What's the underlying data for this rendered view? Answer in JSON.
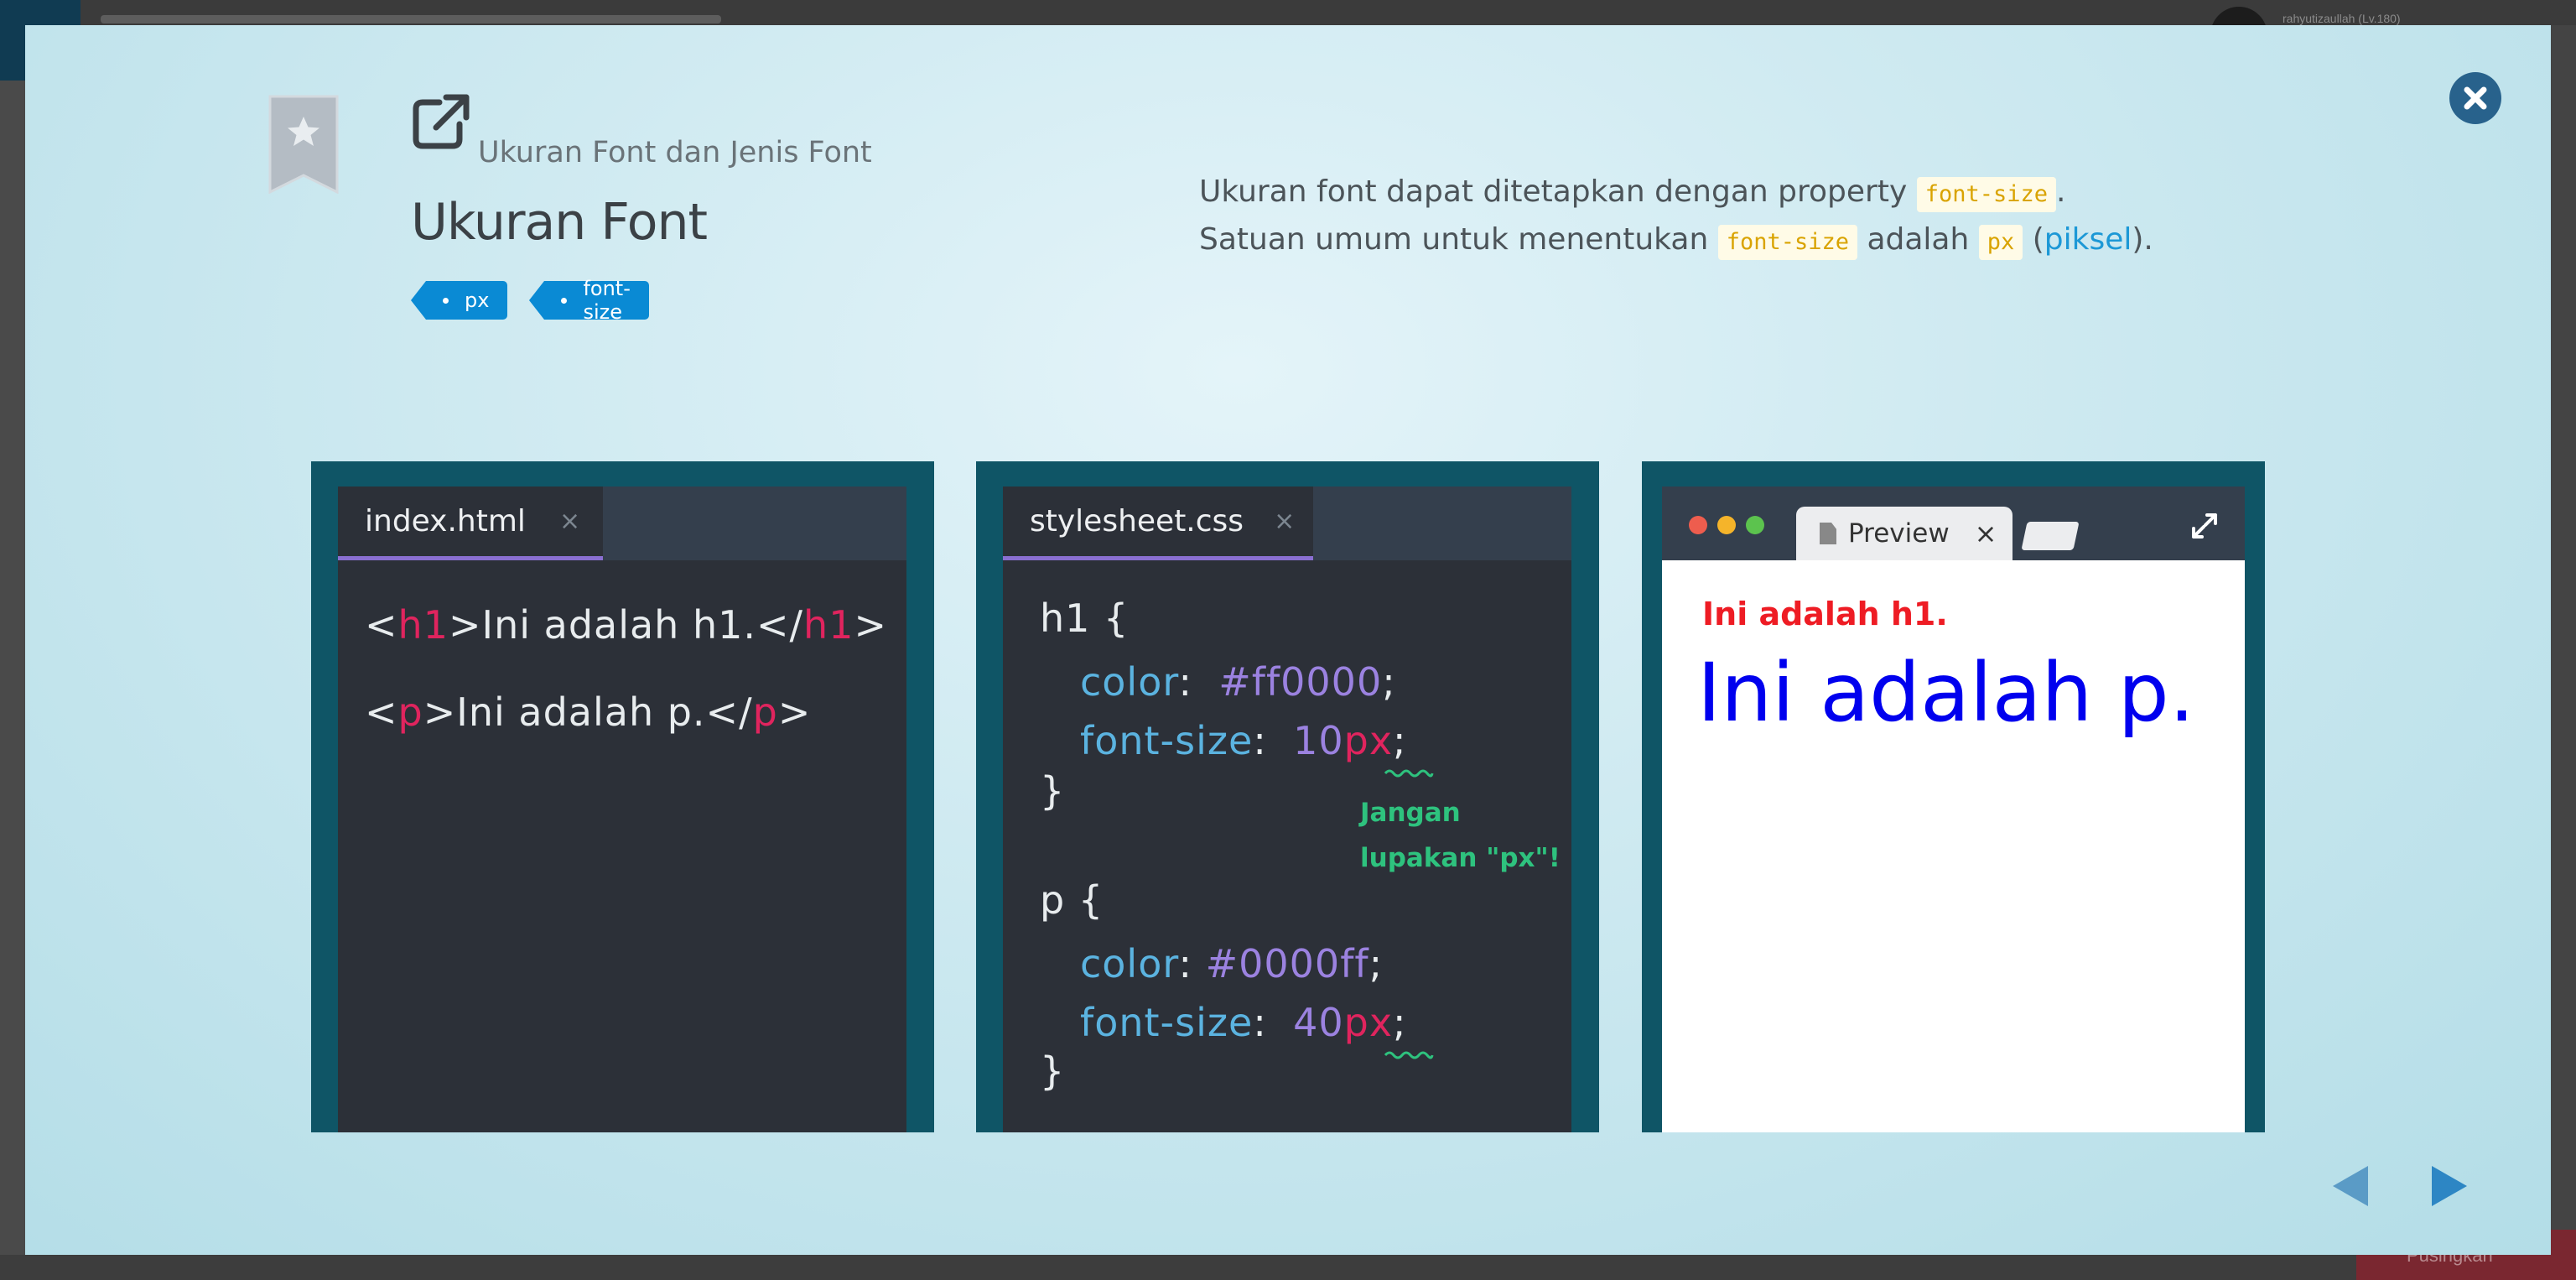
{
  "background": {
    "username": "rahyutizaullah (Lv.180)",
    "bottom_button": "Pusingkan"
  },
  "header": {
    "lesson_title": "Ukuran Font dan Jenis Font",
    "page_title": "Ukuran Font",
    "tags": [
      "px",
      "font-size"
    ]
  },
  "description": {
    "line1_text": "Ukuran font dapat ditetapkan dengan property ",
    "line1_code": "font-size",
    "line1_end": ".",
    "line2_text": "Satuan umum untuk menentukan ",
    "line2_code1": "font-size",
    "line2_mid": " adalah ",
    "line2_code2": "px",
    "line2_paren_open": " (",
    "line2_link": "piksel",
    "line2_paren_close": ")."
  },
  "html_editor": {
    "tab_label": "index.html",
    "tab_close": "×",
    "line1": {
      "open": "<",
      "tag": "h1",
      "mid": ">Ini adalah h1.</",
      "tag2": "h1",
      "close": ">"
    },
    "line2": {
      "open": "<",
      "tag": "p",
      "mid": ">Ini adalah p.</",
      "tag2": "p",
      "close": ">"
    }
  },
  "css_editor": {
    "tab_label": "stylesheet.css",
    "tab_close": "×",
    "rule1_selector": "h1 {",
    "rule1_color_prop": "color",
    "rule1_color_val": "#ff0000",
    "rule1_size_prop": "font-size",
    "rule1_size_num": "10",
    "rule1_size_unit": "px",
    "rule1_close": "}",
    "note_line1": "Jangan",
    "note_line2": "lupakan \"px\"!",
    "rule2_selector": "p {",
    "rule2_color_prop": "color",
    "rule2_color_val": "#0000ff",
    "rule2_size_prop": "font-size",
    "rule2_size_num": "40",
    "rule2_size_unit": "px",
    "rule2_close": "}",
    "colon": ":",
    "semicolon": ";"
  },
  "preview": {
    "tab_label": "Preview",
    "tab_close": "×",
    "output_h1": "Ini adalah h1.",
    "output_p": "Ini adalah p."
  },
  "colors": {
    "accent_blue": "#0a8ad4",
    "panel_teal": "#0f5566",
    "editor_bg": "#2c3038",
    "tag_red": "#e0245e",
    "prop_blue": "#5bb3e0",
    "value_purple": "#9b82e0",
    "note_green": "#2ec27e"
  },
  "icons": [
    "close-icon",
    "bookmark-star-icon",
    "external-link-icon",
    "expand-icon",
    "prev-arrow-icon",
    "next-arrow-icon"
  ]
}
